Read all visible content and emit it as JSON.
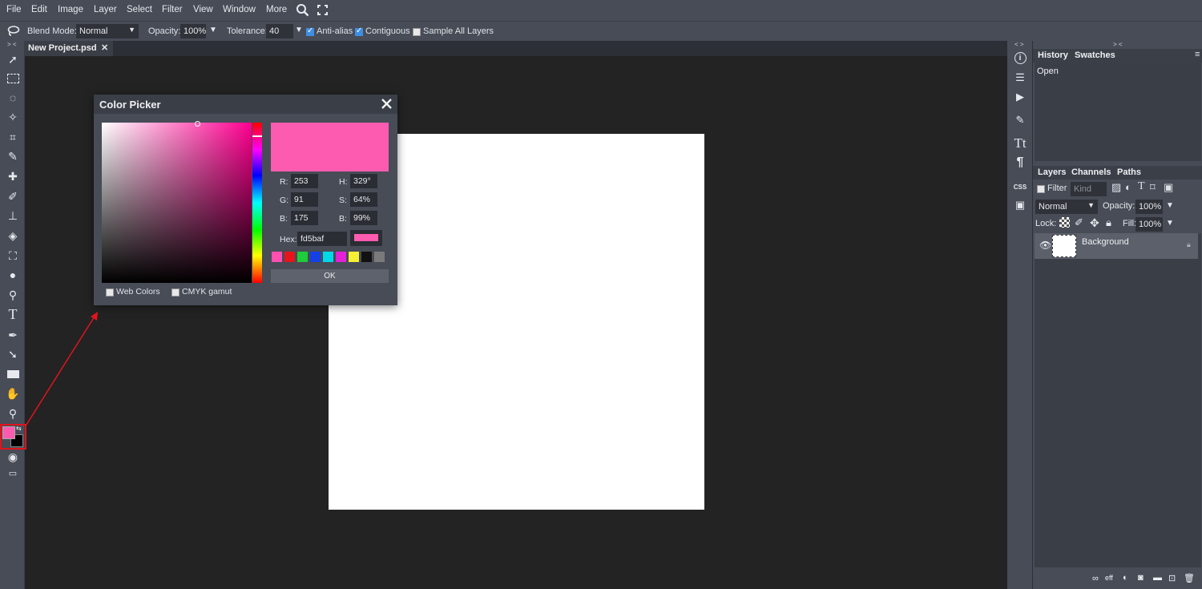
{
  "menu": [
    "File",
    "Edit",
    "Image",
    "Layer",
    "Select",
    "Filter",
    "View",
    "Window",
    "More"
  ],
  "options": {
    "blend_label": "Blend Mode:",
    "blend_value": "Normal",
    "opacity_label": "Opacity:",
    "opacity_value": "100%",
    "tolerance_label": "Tolerance:",
    "tolerance_value": "40",
    "antialias_label": "Anti-alias",
    "contiguous_label": "Contiguous",
    "sample_label": "Sample All Layers"
  },
  "document_tab": {
    "name": "New Project.psd",
    "close": "✕"
  },
  "collapse_left": "> <",
  "collapse_right": "< >",
  "collapse_panel": "> <",
  "color_picker": {
    "title": "Color Picker",
    "r_label": "R:",
    "r_value": "253",
    "g_label": "G:",
    "g_value": "91",
    "b_label": "B:",
    "b_value": "175",
    "h_label": "H:",
    "h_value": "329°",
    "s_label": "S:",
    "s_value": "64%",
    "bv_label": "B:",
    "bv_value": "99%",
    "hex_label": "Hex:",
    "hex_value": "fd5baf",
    "ok_label": "OK",
    "web_colors_label": "Web Colors",
    "cmyk_label": "CMYK gamut",
    "swatches": [
      "#ff4fb0",
      "#e8141c",
      "#1fcc3b",
      "#1540e6",
      "#00d8e8",
      "#e61fd8",
      "#f5f032",
      "#111111",
      "#7a7a7a"
    ],
    "current_color": "#fd5baf"
  },
  "history_panel": {
    "tabs": [
      "History",
      "Swatches"
    ],
    "items": [
      "Open"
    ]
  },
  "layers_panel": {
    "tabs": [
      "Layers",
      "Channels",
      "Paths"
    ],
    "filter_label": "Filter",
    "kind_value": "Kind",
    "blend_value": "Normal",
    "opacity_label": "Opacity:",
    "opacity_value": "100%",
    "lock_label": "Lock:",
    "fill_label": "Fill:",
    "fill_value": "100%",
    "layers": [
      {
        "name": "Background"
      }
    ],
    "footer_eff": "eff"
  },
  "colors": {
    "foreground": "#fd5baf",
    "background": "#000000",
    "annotation": "#e0141c"
  }
}
